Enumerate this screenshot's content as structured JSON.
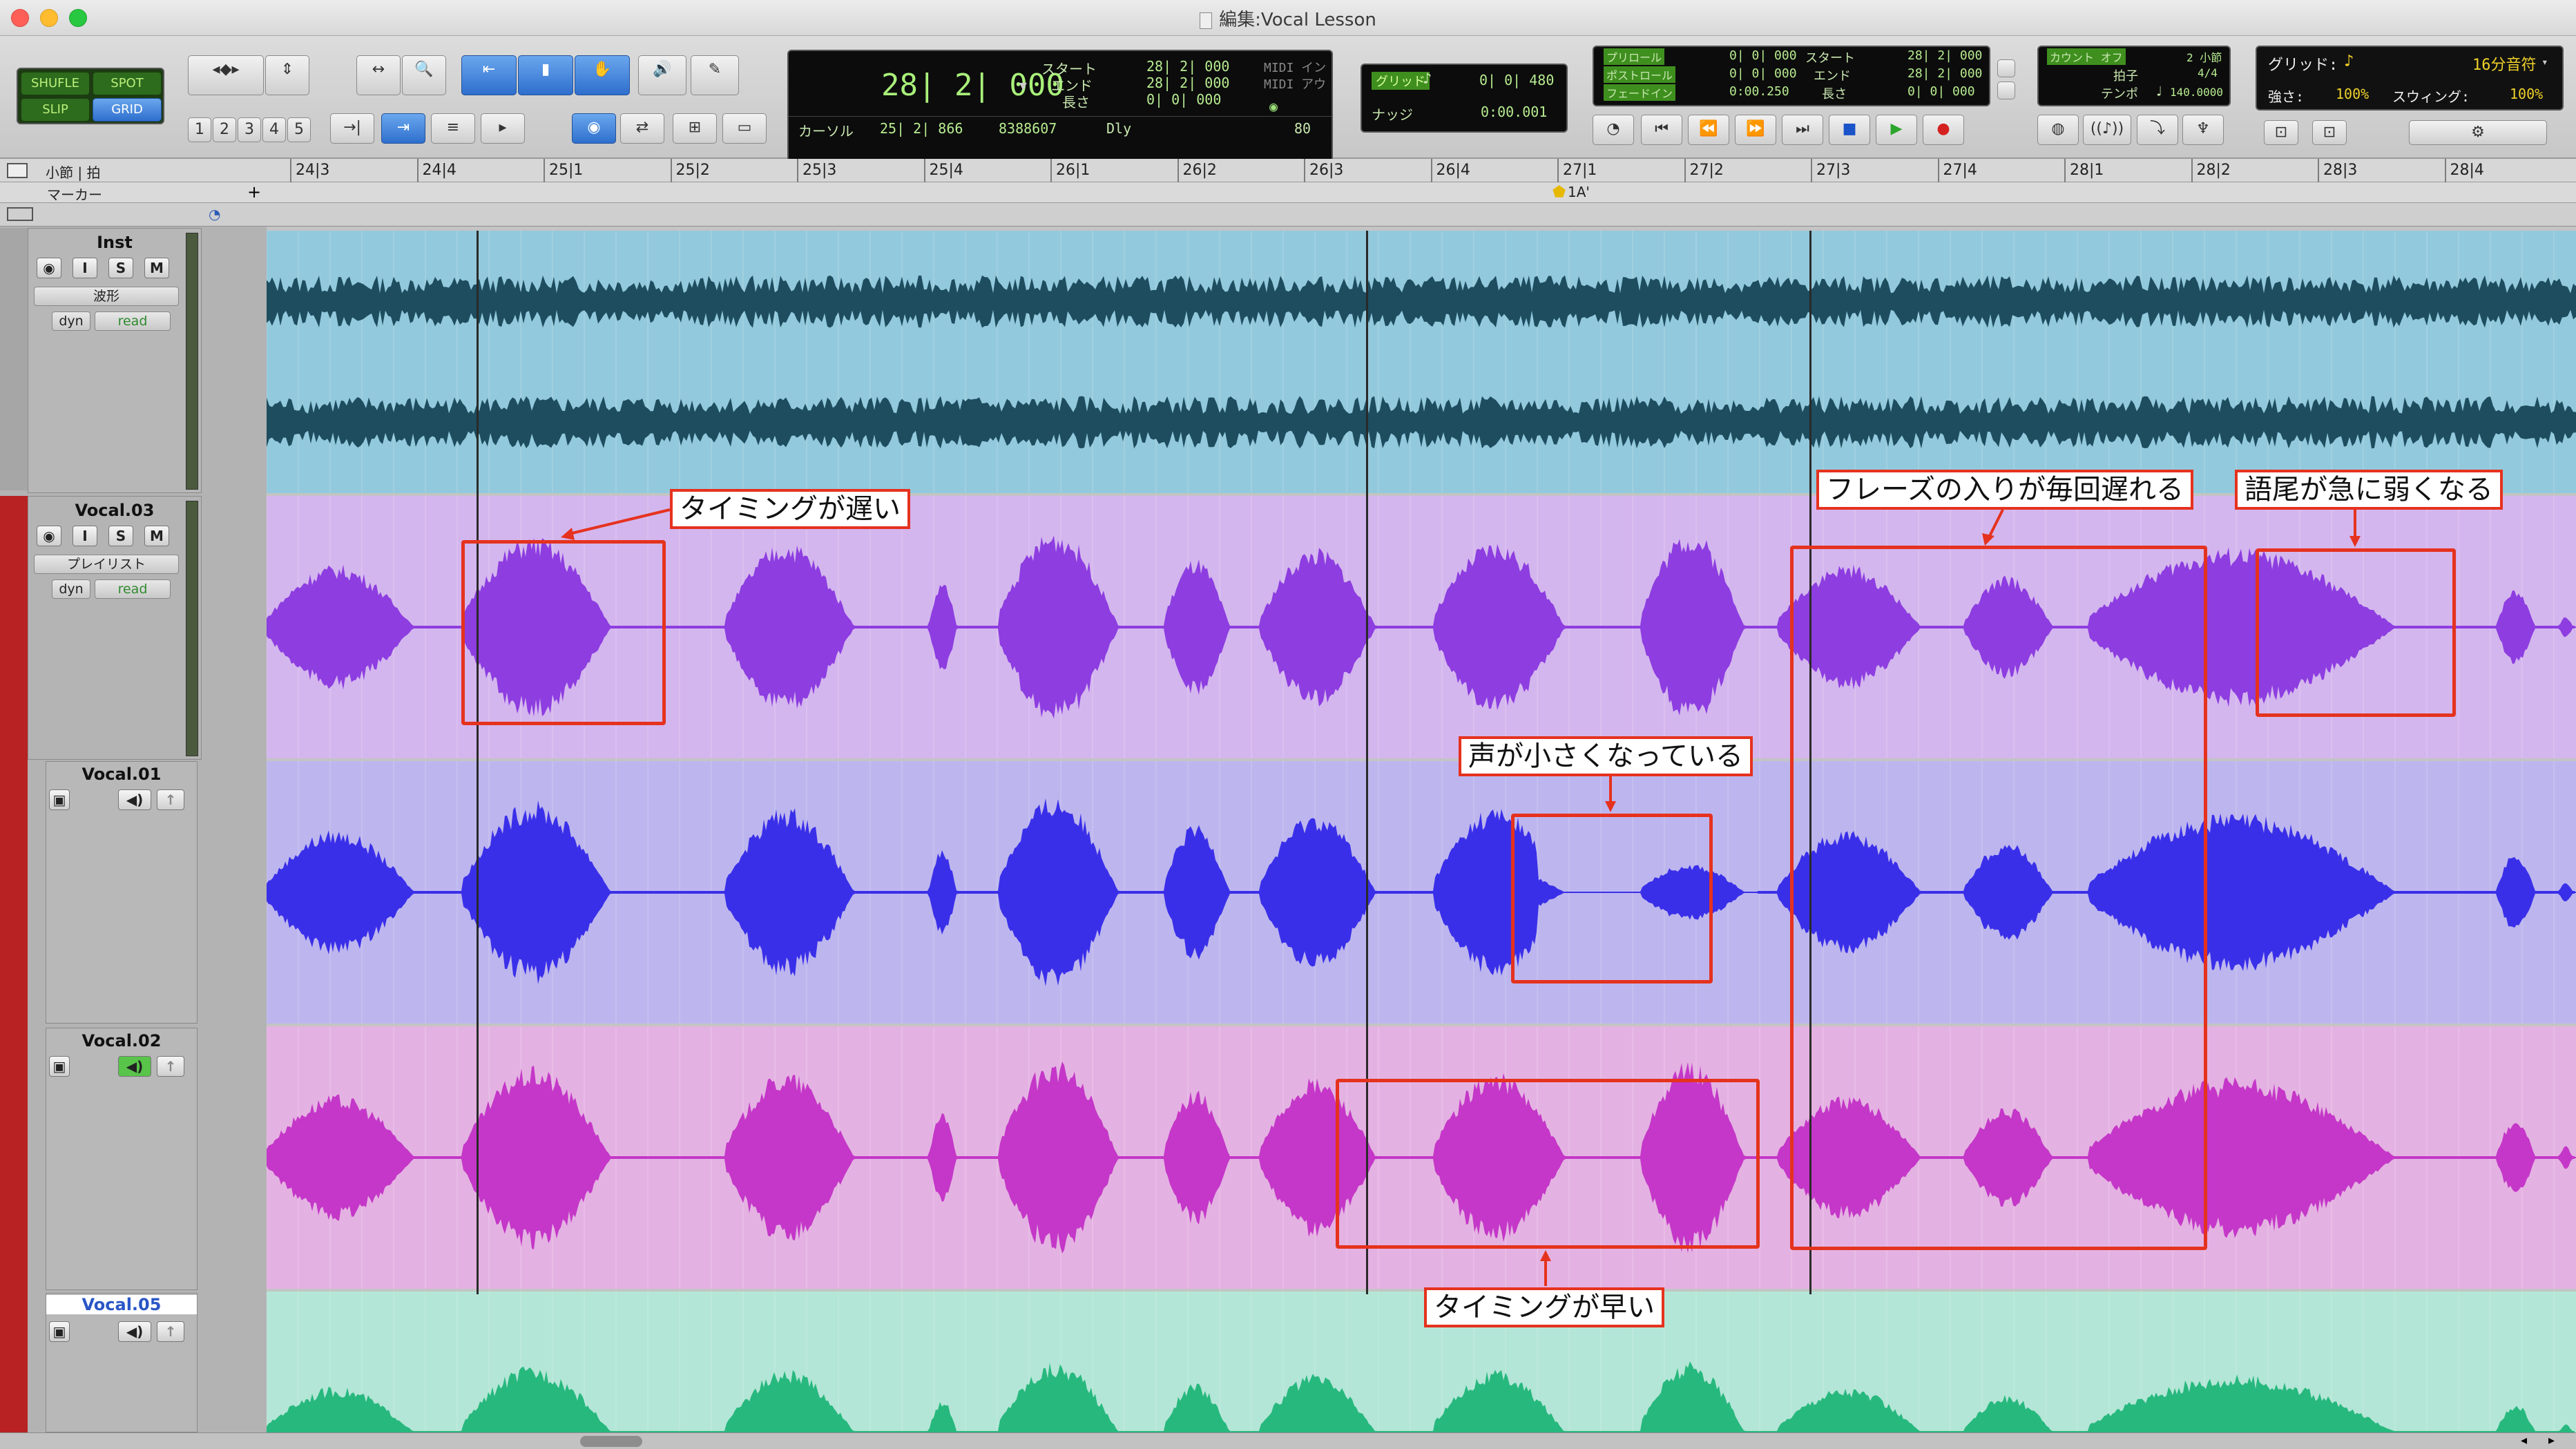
{
  "window": {
    "title": "編集:Vocal Lesson"
  },
  "modes": {
    "shuffle": "SHUFLE",
    "spot": "SPOT",
    "slip": "SLIP",
    "grid": "GRID"
  },
  "zoom_presets": [
    "1",
    "2",
    "3",
    "4",
    "5"
  ],
  "counter": {
    "main": "28| 2| 000",
    "start_label": "スタート",
    "start": "28| 2| 000",
    "end_label": "エンド",
    "end": "28| 2| 000",
    "length_label": "長さ",
    "length": "0| 0| 000",
    "cursor_label": "カーソル",
    "cursor": "25| 2| 866",
    "sample": "8388607",
    "midi_in": "MIDI イン",
    "midi_out": "MIDI アウ",
    "dly": "Dly",
    "value": "80"
  },
  "grid_panel": {
    "grid_label": "グリッド",
    "grid_value": "0| 0| 480",
    "nudge_label": "ナッジ",
    "nudge_value": "0:00.001"
  },
  "transport_counter": {
    "preroll_label": "プリロール",
    "preroll": "0| 0| 000",
    "postroll_label": "ポストロール",
    "postroll": "0| 0| 000",
    "fadein_label": "フェードイン",
    "fadein": "0:00.250",
    "start_label": "スタート",
    "start": "28| 2| 000",
    "end_label": "エンド",
    "end": "28| 2| 000",
    "length_label": "長さ",
    "length": "0| 0| 000"
  },
  "count": {
    "countoff": "カウント オフ",
    "bars": "2 小節",
    "meter_label": "拍子",
    "meter": "4/4",
    "tempo_label": "テンポ",
    "tempo": "140.0000"
  },
  "quantize": {
    "grid_label": "グリッド:",
    "grid_value": "16分音符",
    "strength_label": "強さ:",
    "strength": "100%",
    "swing_label": "スウィング:",
    "swing": "100%"
  },
  "ruler": {
    "label": "小節 | 拍",
    "marker_label": "マーカー",
    "marker_name": "1A'",
    "ticks": [
      "24|3",
      "24|4",
      "25|1",
      "25|2",
      "25|3",
      "25|4",
      "26|1",
      "26|2",
      "26|3",
      "26|4",
      "27|1",
      "27|2",
      "27|3",
      "27|4",
      "28|1",
      "28|2",
      "28|3",
      "28|4"
    ]
  },
  "tracks": [
    {
      "name": "Inst",
      "i": "I",
      "s": "S",
      "m": "M",
      "view": "波形",
      "dyn": "dyn",
      "auto": "read",
      "color": "#93c9dc",
      "wave": "#1d4d5f"
    },
    {
      "name": "Vocal.03",
      "i": "I",
      "s": "S",
      "m": "M",
      "view": "プレイリスト",
      "dyn": "dyn",
      "auto": "read",
      "color": "#d4b6ee",
      "wave": "#8d3de0"
    },
    {
      "name": "Vocal.01",
      "color": "#bdb6ee",
      "wave": "#3a2fe9"
    },
    {
      "name": "Vocal.02",
      "color": "#e4b2e2",
      "wave": "#c437c8"
    },
    {
      "name": "Vocal.05",
      "color": "#b3e6d6",
      "wave": "#27b87e"
    }
  ],
  "annotations": {
    "late": "タイミングが遅い",
    "phrase_late": "フレーズの入りが毎回遅れる",
    "ending_weak": "語尾が急に弱くなる",
    "quiet": "声が小さくなっている",
    "early": "タイミングが早い"
  }
}
